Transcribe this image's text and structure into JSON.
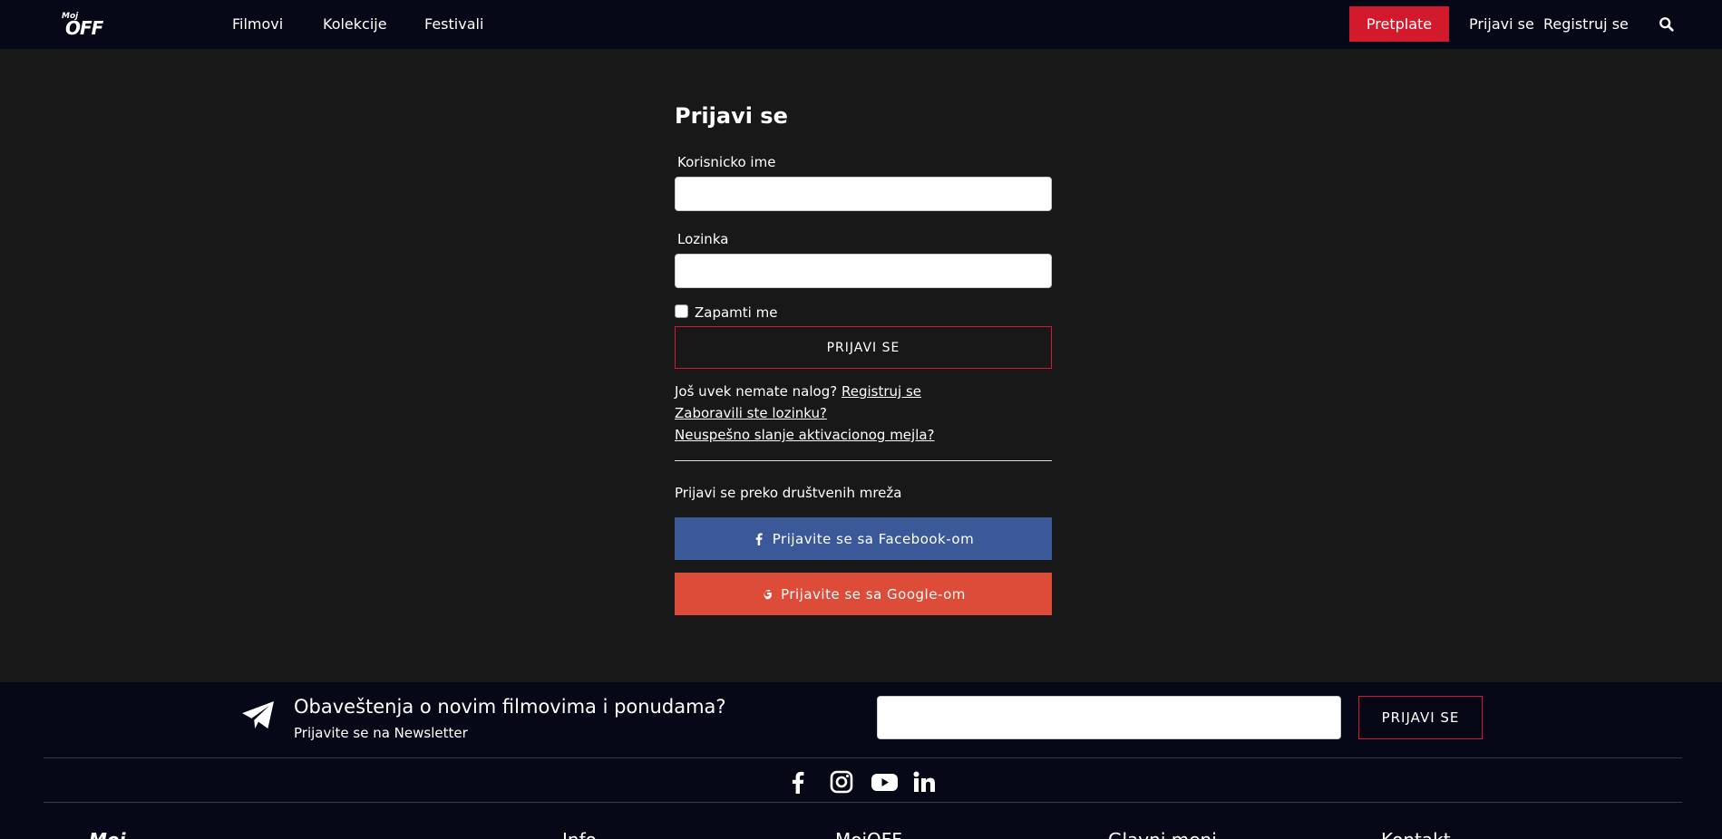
{
  "header": {
    "logo_small": "Moj",
    "logo_main": "OFF",
    "nav": [
      {
        "label": "Filmovi"
      },
      {
        "label": "Kolekcije"
      },
      {
        "label": "Festivali"
      }
    ],
    "subscribe_label": "Pretplate",
    "login_label": "Prijavi se",
    "register_label": "Registruj se"
  },
  "login": {
    "title": "Prijavi se",
    "username_label": "Korisnicko ime",
    "username_value": "",
    "password_label": "Lozinka",
    "password_value": "",
    "remember_label": "Zapamti me",
    "submit_label": "PRIJAVI SE",
    "no_account_text": "Još uvek nemate nalog?",
    "register_link": "Registruj se",
    "forgot_link": "Zaboravili ste lozinku?",
    "activation_link": "Neuspešno slanje aktivacionog mejla?",
    "social_label": "Prijavi se preko društvenih mreža",
    "facebook_label": "Prijavite se sa Facebook-om",
    "google_label": "Prijavite se sa Google-om"
  },
  "footer": {
    "newsletter_title": "Obaveštenja o novim filmovima i ponudama?",
    "newsletter_sub": "Prijavite se na Newsletter",
    "newsletter_value": "",
    "newsletter_button": "PRIJAVI SE",
    "social_icons": [
      "facebook-icon",
      "instagram-icon",
      "youtube-icon",
      "linkedin-icon"
    ],
    "columns": [
      "Moj",
      "Info",
      "MojOFF",
      "Glavni meni",
      "Kontakt"
    ]
  },
  "colors": {
    "accent_red": "#d3192c",
    "facebook": "#3b5998",
    "google": "#dd4b39",
    "header_bg": "#070817",
    "page_bg": "#181818"
  }
}
